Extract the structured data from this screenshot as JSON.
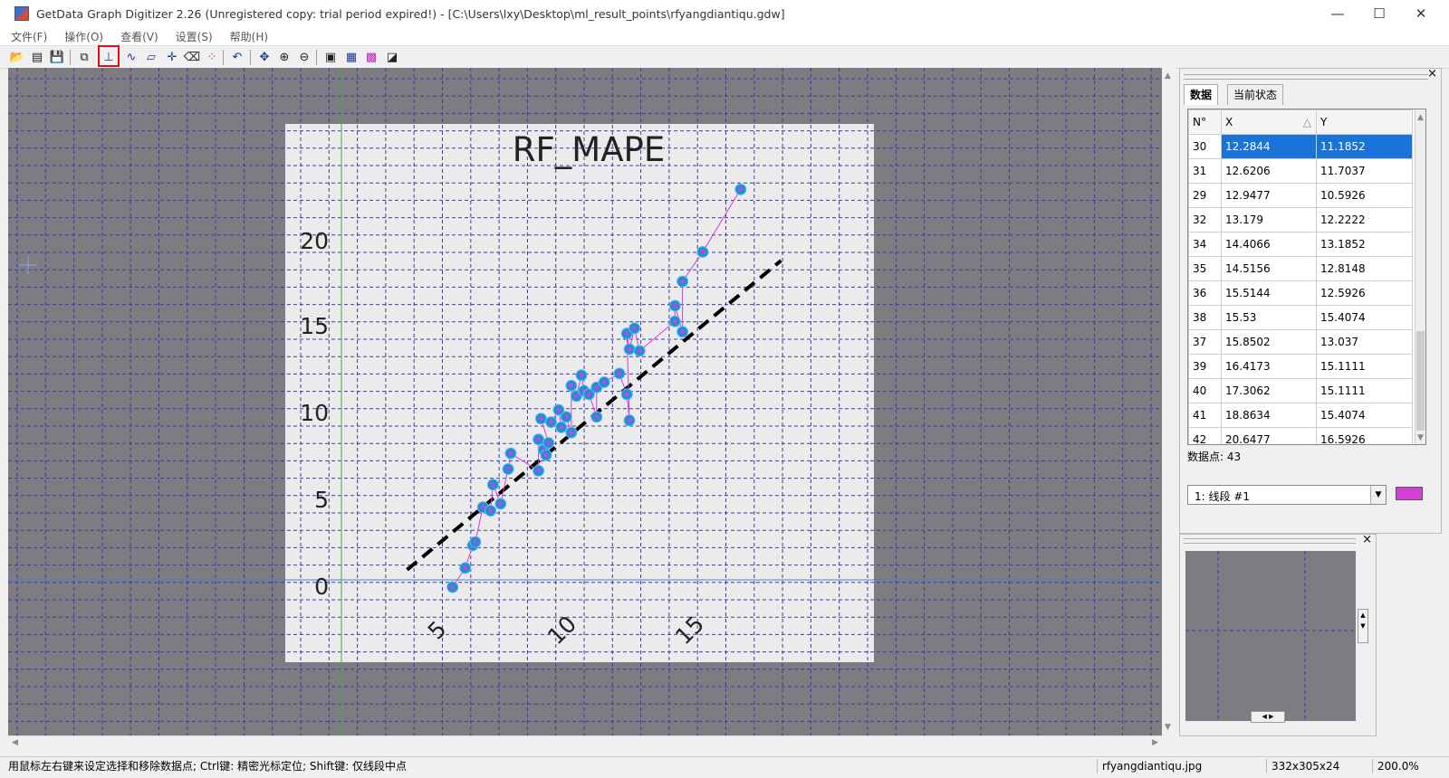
{
  "window": {
    "title": "GetData Graph Digitizer 2.26 (Unregistered copy: trial period expired!) - [C:\\Users\\lxy\\Desktop\\ml_result_points\\rfyangdiantiqu.gdw]",
    "minimize": "—",
    "maximize": "☐",
    "close": "✕"
  },
  "menu": [
    "文件(F)",
    "操作(O)",
    "查看(V)",
    "设置(S)",
    "帮助(H)"
  ],
  "toolbar": {
    "icons": [
      "open-icon",
      "scan-icon",
      "save-icon",
      "copy-icon",
      "point-capture-icon",
      "line-capture-icon",
      "area-capture-icon",
      "cursor-icon",
      "eraser-icon",
      "auto-points-icon",
      "undo-icon",
      "move-icon",
      "zoom-in-icon",
      "zoom-out-icon",
      "image-icon",
      "grid-icon",
      "color-icon",
      "axis-icon"
    ],
    "selected": "point-capture-icon"
  },
  "plot": {
    "title": "RF_MAPE",
    "y_ticks": [
      "20",
      "15",
      "10",
      "5",
      "0"
    ],
    "x_ticks": [
      "5",
      "10",
      "15"
    ]
  },
  "chart_data": {
    "type": "scatter",
    "title": "RF_MAPE",
    "xlabel": "",
    "ylabel": "",
    "xlim": [
      2,
      20
    ],
    "ylim": [
      -2,
      25
    ],
    "x_ticks": [
      5,
      10,
      15
    ],
    "y_ticks": [
      0,
      5,
      10,
      15,
      20
    ],
    "series": [
      {
        "name": "",
        "color": "#1e90d8",
        "points": [
          [
            5.6,
            0.0
          ],
          [
            6.1,
            1.1
          ],
          [
            6.4,
            2.4
          ],
          [
            6.5,
            2.6
          ],
          [
            6.8,
            4.6
          ],
          [
            7.1,
            4.4
          ],
          [
            7.2,
            5.9
          ],
          [
            7.5,
            4.8
          ],
          [
            7.8,
            6.8
          ],
          [
            7.9,
            7.7
          ],
          [
            9.0,
            6.7
          ],
          [
            9.0,
            8.5
          ],
          [
            9.2,
            7.9
          ],
          [
            9.3,
            7.6
          ],
          [
            9.4,
            8.3
          ],
          [
            9.1,
            9.7
          ],
          [
            9.5,
            9.5
          ],
          [
            9.8,
            10.2
          ],
          [
            9.9,
            9.2
          ],
          [
            10.1,
            9.8
          ],
          [
            10.3,
            8.9
          ],
          [
            10.3,
            11.6
          ],
          [
            10.5,
            11.0
          ],
          [
            10.7,
            12.2
          ],
          [
            10.8,
            11.3
          ],
          [
            11.0,
            11.1
          ],
          [
            11.3,
            9.8
          ],
          [
            11.3,
            11.5
          ],
          [
            11.6,
            11.8
          ],
          [
            12.2,
            12.3
          ],
          [
            12.5,
            11.1
          ],
          [
            12.6,
            9.6
          ],
          [
            12.5,
            14.6
          ],
          [
            12.6,
            13.7
          ],
          [
            12.8,
            14.9
          ],
          [
            13.0,
            13.6
          ],
          [
            14.4,
            15.3
          ],
          [
            14.4,
            16.2
          ],
          [
            14.7,
            14.7
          ],
          [
            14.7,
            17.6
          ],
          [
            15.5,
            19.3
          ],
          [
            17.0,
            22.9
          ]
        ]
      }
    ],
    "reference_line": {
      "style": "dashed",
      "color": "#000000",
      "x": [
        3.8,
        18.6
      ],
      "y": [
        1.0,
        18.8
      ]
    }
  },
  "right_panel": {
    "tabs": [
      "数据",
      "当前状态"
    ],
    "columns": [
      "N°",
      "X",
      "Y"
    ],
    "rows": [
      [
        "30",
        "12.2844",
        "11.1852"
      ],
      [
        "31",
        "12.6206",
        "11.7037"
      ],
      [
        "29",
        "12.9477",
        "10.5926"
      ],
      [
        "32",
        "13.179",
        "12.2222"
      ],
      [
        "34",
        "14.4066",
        "13.1852"
      ],
      [
        "35",
        "14.5156",
        "12.8148"
      ],
      [
        "36",
        "15.5144",
        "12.5926"
      ],
      [
        "38",
        "15.53",
        "15.4074"
      ],
      [
        "37",
        "15.8502",
        "13.037"
      ],
      [
        "39",
        "16.4173",
        "15.1111"
      ],
      [
        "40",
        "17.3062",
        "15.1111"
      ],
      [
        "41",
        "18.8634",
        "15.4074"
      ],
      [
        "42",
        "20.6477",
        "16.5926"
      ]
    ],
    "selected_row": 0,
    "point_count": "数据点: 43",
    "series_select": "1: 线段 #1",
    "series_color": "#d43fd4",
    "close": "×"
  },
  "status": {
    "hint": "用鼠标左右键来设定选择和移除数据点; Ctrl键: 精密光标定位; Shift键: 仅线段中点",
    "file": "rfyangdiantiqu.jpg",
    "size": "332x305x24",
    "zoom": "200.0%"
  }
}
